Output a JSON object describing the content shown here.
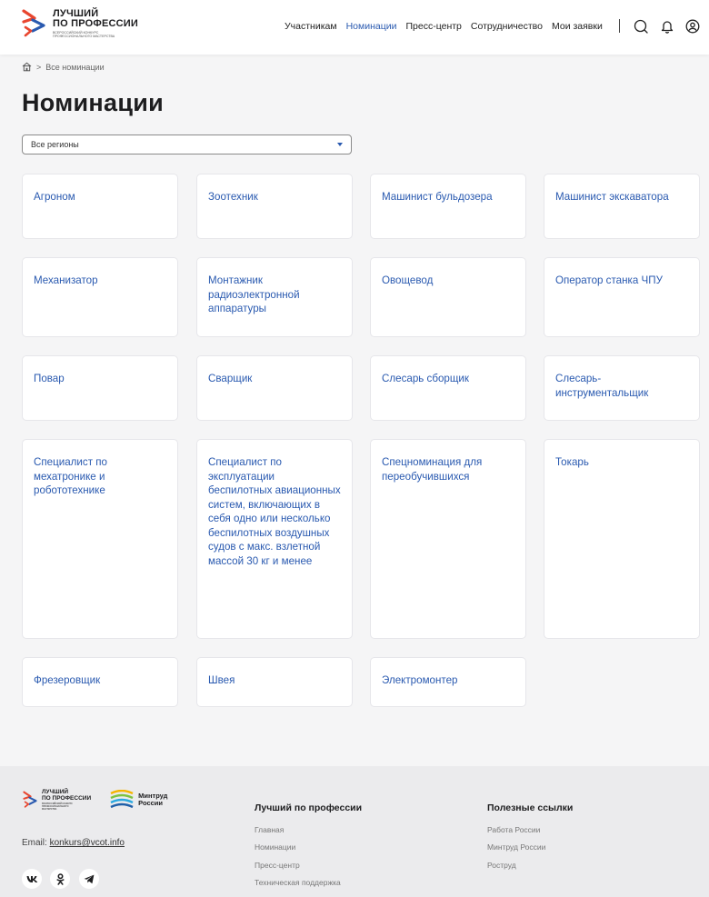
{
  "header": {
    "logo_line1": "ЛУЧШИЙ",
    "logo_line2": "ПО ПРОФЕССИИ",
    "logo_sub": "ВСЕРОССИЙСКИЙ КОНКУРС ПРОФЕССИОНАЛЬНОГО МАСТЕРСТВА",
    "nav": [
      "Участникам",
      "Номинации",
      "Пресс-центр",
      "Сотрудничество",
      "Мои заявки"
    ],
    "active_nav": "Номинации",
    "icons": [
      "search-icon",
      "bell-icon",
      "user-icon"
    ]
  },
  "breadcrumb": {
    "separator": ">",
    "current": "Все номинации"
  },
  "page_title": "Номинации",
  "region_select": {
    "value": "Все регионы"
  },
  "nominations": [
    "Агроном",
    "Зоотехник",
    "Машинист бульдозера",
    "Машинист экскаватора",
    "Механизатор",
    "Монтажник радиоэлектронной аппаратуры",
    "Овощевод",
    "Оператор станка ЧПУ",
    "Повар",
    "Сварщик",
    "Слесарь сборщик",
    "Слесарь-инструментальщик",
    "Специалист по мехатронике и робототехнике",
    "Специалист по эксплуатации беспилотных авиационных систем, включающих в себя одно или несколько беспилотных воздушных судов с макс. взлетной массой 30 кг и менее",
    "Спецноминация для переобучившихся",
    "Токарь",
    "Фрезеровщик",
    "Швея",
    "Электромонтер"
  ],
  "footer": {
    "logo_line1": "ЛУЧШИЙ",
    "logo_line2": "ПО ПРОФЕССИИ",
    "logo_sub": "ВСЕРОССИЙСКИЙ КОНКУРС ПРОФЕССИОНАЛЬНОГО МАСТЕРСТВА",
    "mintrud_line1": "Минтруд",
    "mintrud_line2": "России",
    "email_label": "Email:",
    "email": "konkurs@vcot.info",
    "socials": [
      "vk-icon",
      "ok-icon",
      "telegram-icon"
    ],
    "col1_title": "Лучший по профессии",
    "col1_links": [
      "Главная",
      "Номинации",
      "Пресс-центр",
      "Техническая поддержка"
    ],
    "col2_title": "Полезные ссылки",
    "col2_links": [
      "Работа России",
      "Минтруд России",
      "Роструд"
    ]
  },
  "colors": {
    "accent": "#2a5ab0",
    "logo_red": "#e8462f",
    "logo_blue": "#2a5ab0",
    "background": "#f5f5f6"
  }
}
